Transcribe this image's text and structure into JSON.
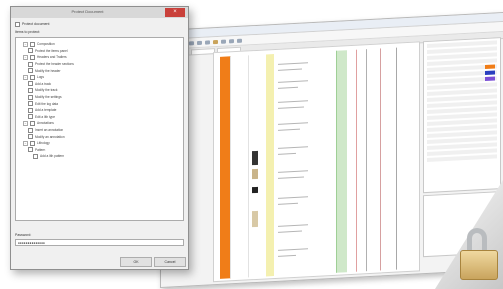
{
  "app": {
    "title": "",
    "track_colors": {
      "lithology_strip": "#f07d18",
      "yellow_track": "#f4f0b0",
      "green_track": "#cfe8c9"
    }
  },
  "dialog": {
    "title": "Protect Document",
    "close_glyph": "×",
    "protect_checkbox_label": "Protect document",
    "section_label": "Items to protect:",
    "tree": [
      {
        "label": "Composition",
        "indent": 1,
        "expander": "−"
      },
      {
        "label": "Protect the items panel",
        "indent": 2,
        "expander": ""
      },
      {
        "label": "Headers and Trailers",
        "indent": 1,
        "expander": "−"
      },
      {
        "label": "Protect the header sections",
        "indent": 2,
        "expander": ""
      },
      {
        "label": "Modify the header",
        "indent": 2,
        "expander": ""
      },
      {
        "label": "Logs",
        "indent": 1,
        "expander": "−"
      },
      {
        "label": "Add a track",
        "indent": 2,
        "expander": ""
      },
      {
        "label": "Modify the track",
        "indent": 2,
        "expander": ""
      },
      {
        "label": "Modify the settings",
        "indent": 2,
        "expander": ""
      },
      {
        "label": "Edit the log data",
        "indent": 2,
        "expander": ""
      },
      {
        "label": "Add a template",
        "indent": 2,
        "expander": ""
      },
      {
        "label": "Edit a lith type",
        "indent": 2,
        "expander": ""
      },
      {
        "label": "Annotations",
        "indent": 1,
        "expander": "−"
      },
      {
        "label": "Insert an annotation",
        "indent": 2,
        "expander": ""
      },
      {
        "label": "Modify an annotation",
        "indent": 2,
        "expander": ""
      },
      {
        "label": "Lithology",
        "indent": 1,
        "expander": "−"
      },
      {
        "label": "Pattern",
        "indent": 2,
        "expander": ""
      },
      {
        "label": "Add a lith pattern",
        "indent": 3,
        "expander": ""
      }
    ],
    "password_label": "Password:",
    "password_value": "●●●●●●●●●●●●●●",
    "ok_label": "OK",
    "cancel_label": "Cancel"
  }
}
